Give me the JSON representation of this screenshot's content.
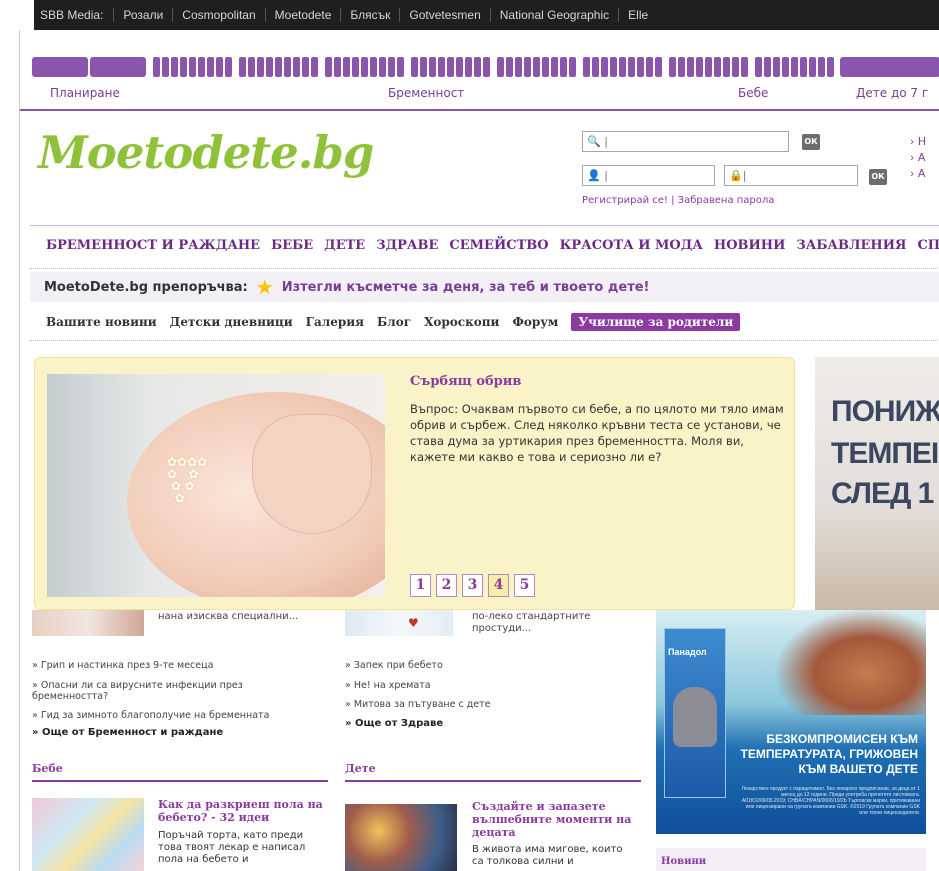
{
  "network": {
    "label": "SBB Media:",
    "links": [
      "Розали",
      "Cosmopolitan",
      "Moetodete",
      "Блясък",
      "Gotvetesmen",
      "National Geographic",
      "Elle"
    ]
  },
  "timeline": {
    "labels": [
      "Планиране",
      "Бременност",
      "Бебе",
      "Дете до 7 г"
    ]
  },
  "logo": "Moetodete.bg",
  "login": {
    "search_placeholder": "",
    "ok_label": "ОК",
    "register_link": "Регистрирай се!",
    "forgot_link": "Забравена парола",
    "quick_links": [
      "Н",
      "А",
      "А"
    ]
  },
  "main_nav": [
    "БРЕМЕННОСТ И РАЖДАНЕ",
    "БЕБЕ",
    "ДЕТЕ",
    "ЗДРАВЕ",
    "СЕМЕЙСТВО",
    "КРАСОТА И МОДА",
    "НОВИНИ",
    "ЗАБАВЛЕНИЯ",
    "СПРАВ"
  ],
  "recommend": {
    "label": "MoetoDete.bg препоръчва:",
    "text": "Изтегли късметче за деня, за теб и твоето дете!"
  },
  "sub_nav": [
    "Вашите новини",
    "Детски дневници",
    "Галерия",
    "Блог",
    "Хороскопи",
    "Форум",
    "Училище за родители"
  ],
  "feature": {
    "title": "Сърбящ обрив",
    "text": "Въпрос: Очаквам първото си бебе, а по цялото ми тяло имам обрив и сърбеж. След няколко кръвни теста се установи, че става дума за уртикария през бременността. Моля ви, кажете ми какво е това и сериозно ли е?",
    "pages": [
      "1",
      "2",
      "3",
      "4",
      "5"
    ],
    "active_page": "4"
  },
  "ad_top": {
    "lines": [
      "ПОНИЖ",
      "ТЕМПЕІ",
      "СЛЕД 1"
    ]
  },
  "lower": {
    "left_partial": "нана изисква специални...",
    "mid_partial_1": "по-леко стандартните",
    "mid_partial_2": "простуди...",
    "left_links": [
      "Грип и настинка през 9-те месеца",
      "Опасни ли са вирусните инфекции през бременността?",
      "Гид за зимното благополучие на бременната"
    ],
    "left_more": "Още от Бременност и раждане",
    "mid_links": [
      "Запек при бебето",
      "Не! на хремата",
      "Митова за пътуване с дете"
    ],
    "mid_more": "Още от Здраве",
    "sections": [
      "Бебе",
      "Дете"
    ],
    "baby_title": "Как да разкриеш пола на бебето? - 32 идеи",
    "baby_text": "Поръчай торта, като преди това твоят лекар е написал пола на бебето и",
    "child_title": "Създайте и запазете вълшебните моменти на децата",
    "child_text": "В живота има мигове, които са толкова силни и"
  },
  "ad_panadol": {
    "brand": "Панадол",
    "headline": [
      "БЕЗКОМПРОМИСЕН КЪМ",
      "ТЕМПЕРАТУРАТА, ГРИЖОВЕН",
      "КЪМ ВАШЕТО ДЕТЕ"
    ],
    "fine": "Лекарствен продукт с парацетамол. Без лекарско предписание, за деца от 1 месец до 12 години. Преди употреба прочетете листовката. А01Ю2/09/05.2019; CHBA/CHPAN/0006/19/2b Търговски марки, притежавани или лицензирани на групата компании GSK. ©2019 Групата компании GSK или техни лицензодатели."
  },
  "news_box": "Новини"
}
